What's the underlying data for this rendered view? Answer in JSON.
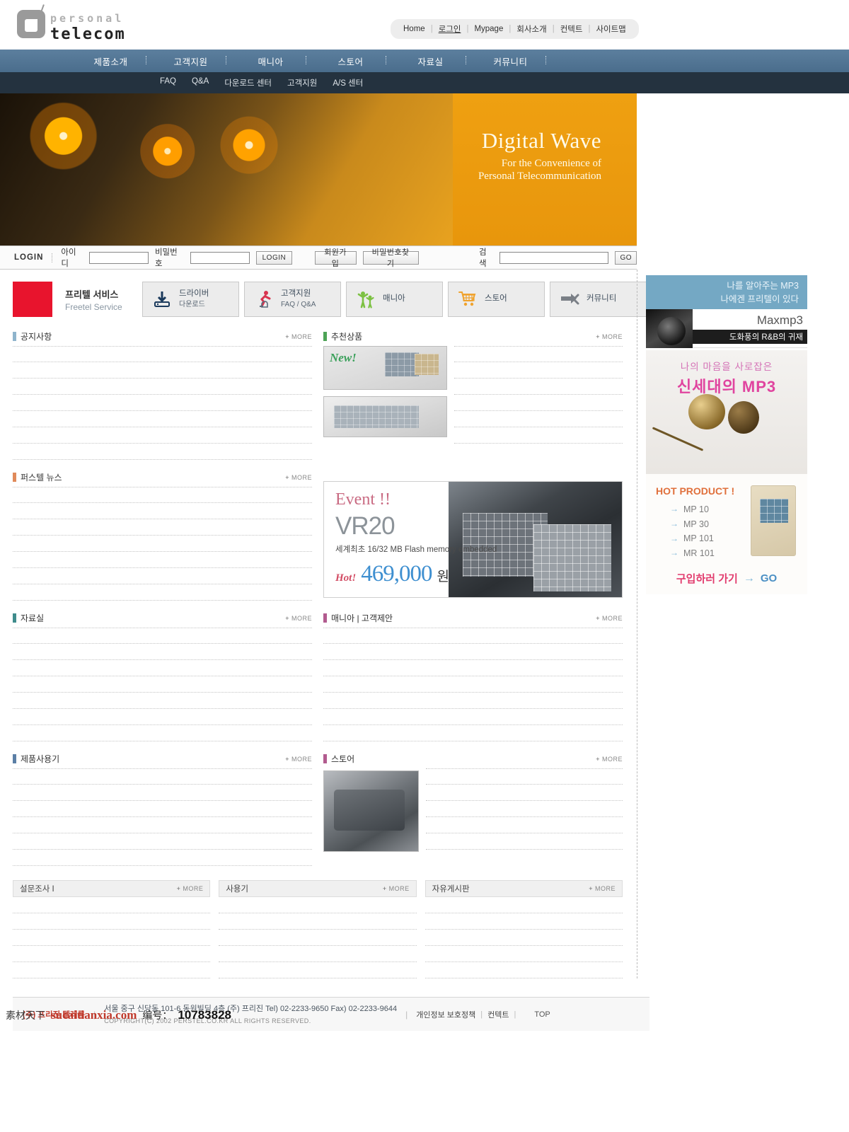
{
  "site": {
    "logo_top": "personal",
    "logo_bottom": "telecom"
  },
  "util_nav": {
    "items": [
      "Home",
      "로그인",
      "Mypage",
      "회사소개",
      "컨텍트",
      "사이트맵"
    ],
    "separator": "|"
  },
  "main_nav": {
    "items": [
      "제품소개",
      "고객지원",
      "매니아",
      "스토어",
      "자료실",
      "커뮤니티"
    ]
  },
  "sub_nav": {
    "items": [
      "FAQ",
      "Q&A",
      "다운로드 센터",
      "고객지원",
      "A/S 센터"
    ]
  },
  "hero": {
    "title": "Digital Wave",
    "subtitle_line1": "For the Convenience of",
    "subtitle_line2": "Personal Telecommunication"
  },
  "login_bar": {
    "label": "LOGIN",
    "id_label": "아이디",
    "id_value": "",
    "pw_label": "비밀번호",
    "pw_value": "",
    "login_button": "LOGIN",
    "join_button": "회원가입",
    "findpw_button": "비밀번호찾기",
    "search_label": "검색",
    "search_value": "",
    "search_button": "GO"
  },
  "quick_menu": {
    "brand_ko": "프리텔 서비스",
    "brand_en": "Freetel Service",
    "buttons": [
      {
        "icon": "download-icon",
        "label": "드라이버",
        "sublabel": "다운로드"
      },
      {
        "icon": "running-man-icon",
        "label": "고객지원",
        "sublabel": "FAQ / Q&A"
      },
      {
        "icon": "people-icon",
        "label": "매니아",
        "sublabel": ""
      },
      {
        "icon": "cart-icon",
        "label": "스토어",
        "sublabel": ""
      },
      {
        "icon": "arrows-icon",
        "label": "커뮤니티",
        "sublabel": ""
      }
    ]
  },
  "panels": {
    "notice": {
      "title": "공지사항",
      "more": "MORE",
      "bullet_color": "#8fb4cc",
      "rows": 7
    },
    "news": {
      "title": "퍼스텔 뉴스",
      "more": "MORE",
      "bullet_color": "#e08a5a",
      "rows": 7
    },
    "archive": {
      "title": "자료실",
      "more": "MORE",
      "bullet_color": "#3f8c8c",
      "rows": 7
    },
    "review": {
      "title": "제품사용기",
      "more": "MORE",
      "bullet_color": "#5b7fa6",
      "rows": 6
    },
    "recommend": {
      "title": "추천상품",
      "more": "MORE",
      "bullet_color": "#4da356",
      "rows": 5,
      "new_badge": "New!"
    },
    "mania": {
      "title": "매니아 | 고객제안",
      "more": "MORE",
      "bullet_color": "#b25b8f",
      "rows": 7
    },
    "store": {
      "title": "스토어",
      "more": "MORE",
      "bullet_color": "#b25b8f",
      "rows": 5
    }
  },
  "event_banner": {
    "heading": "Event !!",
    "model": "VR20",
    "description": "세계최초  16/32 MB Flash memory embedded",
    "hot_label": "Hot!",
    "price": "469,000",
    "currency": "원"
  },
  "bottom_panels": [
    {
      "title": "설문조사 I",
      "more": "MORE",
      "rows": 5
    },
    {
      "title": "사용기",
      "more": "MORE",
      "rows": 5
    },
    {
      "title": "자유게시판",
      "more": "MORE",
      "rows": 5
    }
  ],
  "sidebar": {
    "ad_head_line1": "나를 알아주는 MP3",
    "ad_head_line2": "나에겐 프리텔이 있다",
    "maxmp3_title": "Maxmp3",
    "maxmp3_tag": "도화풍의 R&B의 귀재",
    "mp3_line1": "나의 마음을 사로잡은",
    "mp3_line2": "신세대의 MP3",
    "hot_title": "HOT PRODUCT !",
    "hot_items": [
      "MP 10",
      "MP 30",
      "MP 101",
      "MR 101"
    ],
    "go_ko": "구입하러 가기",
    "go_en": "GO"
  },
  "footer": {
    "company": "(주) 프리진 텔레콤",
    "address": "서울 중구 신당동 101-6 동원빌딩 4층  (주) 프리진 Tel) 02-2233-9650 Fax) 02-2233-9644",
    "copyright": "COPYRIGHT(C) 2002 PERSTEL.CO.KR ALL RIGHTS RESERVED.",
    "links": [
      "개인정보 보호정책",
      "컨텍트"
    ],
    "top_label": "TOP"
  },
  "watermark": {
    "cn": "素材天下",
    "url": "sucaitianxia.com",
    "id_label": "编号：",
    "id_value": "10783828"
  }
}
